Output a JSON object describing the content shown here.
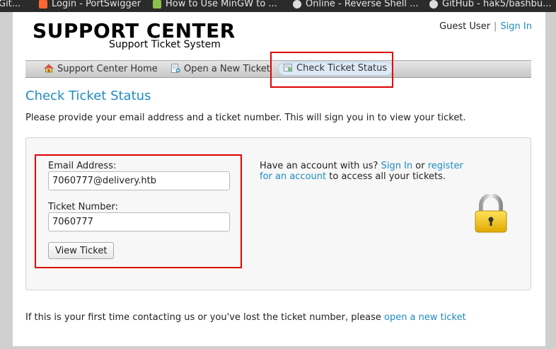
{
  "bookmarks": [
    {
      "label": "Git...",
      "icon": "git-icon",
      "color": "#e8e8e8"
    },
    {
      "label": "Login - PortSwigger",
      "icon": "portswigger-icon",
      "color": "#ff6633"
    },
    {
      "label": "How to Use MinGW to ...",
      "icon": "wikihow-icon",
      "color": "#8bc34a"
    },
    {
      "label": "Online - Reverse Shell ...",
      "icon": "skull-icon",
      "color": "#dddddd"
    },
    {
      "label": "GitHub - hak5/bashbu...",
      "icon": "github-icon",
      "color": "#dddddd"
    }
  ],
  "header": {
    "title": "SUPPORT CENTER",
    "subtitle": "Support Ticket System",
    "user": "Guest User",
    "separator": "|",
    "sign_in": "Sign In"
  },
  "nav": {
    "items": [
      {
        "label": "Support Center Home",
        "icon": "home-icon",
        "active": false
      },
      {
        "label": "Open a New Ticket",
        "icon": "new-ticket-icon",
        "active": false
      },
      {
        "label": "Check Ticket Status",
        "icon": "ticket-status-icon",
        "active": true
      }
    ]
  },
  "main": {
    "title": "Check Ticket Status",
    "intro": "Please provide your email address and a ticket number. This will sign you in to view your ticket.",
    "form": {
      "email_label": "Email Address:",
      "email_value": "7060777@delivery.htb",
      "ticket_label": "Ticket Number:",
      "ticket_value": "7060777",
      "button": "View Ticket"
    },
    "account": {
      "prefix": "Have an account with us?",
      "sign_in": "Sign In",
      "or": "or",
      "register": "register for an account",
      "suffix": "to access all your tickets."
    },
    "footer": {
      "text": "If this is your first time contacting us or you've lost the ticket number, please",
      "link": "open a new ticket"
    }
  },
  "colors": {
    "link": "#1e8bc3",
    "highlight_box": "#e00000",
    "lock_gold": "#f2c200"
  }
}
